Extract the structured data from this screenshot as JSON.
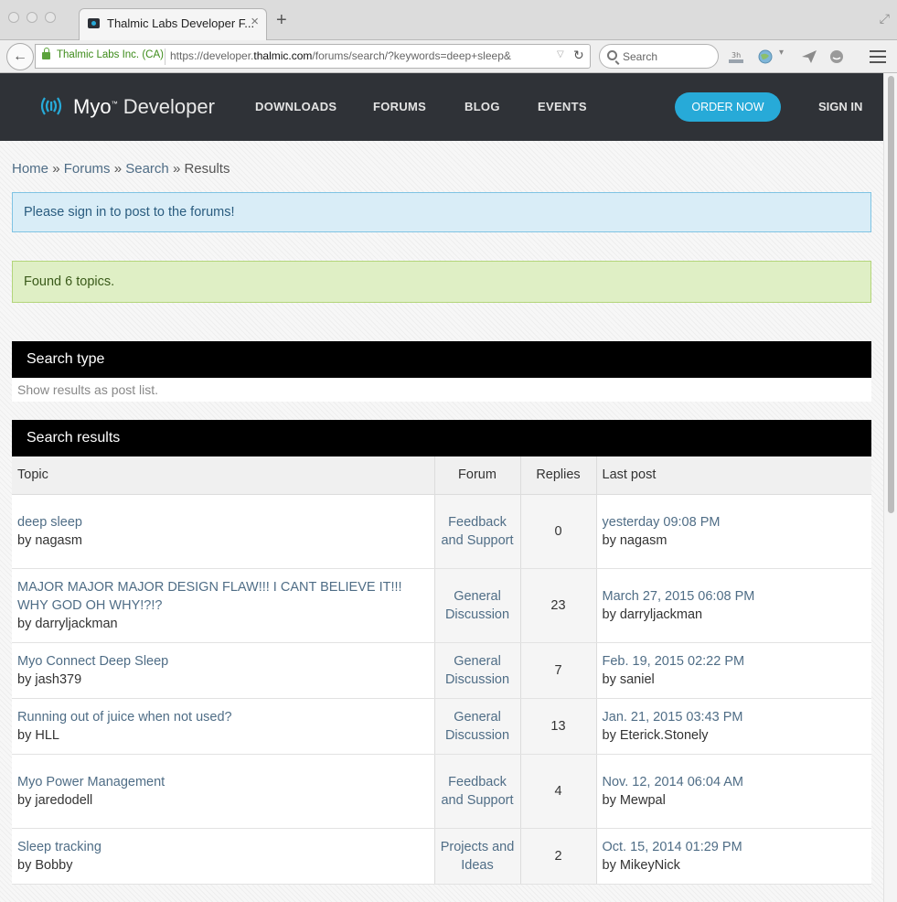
{
  "browser": {
    "tab_title": "Thalmic Labs Developer F...",
    "identity": "Thalmic Labs Inc. (CA)",
    "url_prefix": "https://developer.",
    "url_domain": "thalmic.com",
    "url_suffix": "/forums/search/?keywords=deep+sleep&",
    "search_placeholder": "Search"
  },
  "header": {
    "logo_brand": "Myo",
    "logo_suffix": "Developer",
    "nav": [
      "DOWNLOADS",
      "FORUMS",
      "BLOG",
      "EVENTS"
    ],
    "order_button": "ORDER NOW",
    "sign_in": "SIGN IN"
  },
  "breadcrumb": {
    "home": "Home",
    "forums": "Forums",
    "search": "Search",
    "current": "Results",
    "separator": "»"
  },
  "alerts": {
    "info": "Please sign in to post to the forums!",
    "success": "Found 6 topics."
  },
  "search_type": {
    "title": "Search type",
    "option": "Show results as post list."
  },
  "results": {
    "title": "Search results",
    "columns": {
      "topic": "Topic",
      "forum": "Forum",
      "replies": "Replies",
      "last_post": "Last post"
    },
    "rows": [
      {
        "topic": "deep sleep",
        "author": "by nagasm",
        "forum": "Feedback and Support",
        "replies": "0",
        "last_date": "yesterday 09:08 PM",
        "last_author": "by nagasm"
      },
      {
        "topic": "MAJOR MAJOR MAJOR DESIGN FLAW!!! I CANT BELIEVE IT!!! WHY GOD OH WHY!?!?",
        "author": "by darryljackman",
        "forum": "General Discussion",
        "replies": "23",
        "last_date": "March 27, 2015 06:08 PM",
        "last_author": "by darryljackman"
      },
      {
        "topic": "Myo Connect Deep Sleep",
        "author": "by jash379",
        "forum": "General Discussion",
        "replies": "7",
        "last_date": "Feb. 19, 2015 02:22 PM",
        "last_author": "by saniel"
      },
      {
        "topic": "Running out of juice when not used?",
        "author": "by HLL",
        "forum": "General Discussion",
        "replies": "13",
        "last_date": "Jan. 21, 2015 03:43 PM",
        "last_author": "by Eterick.Stonely"
      },
      {
        "topic": "Myo Power Management",
        "author": "by jaredodell",
        "forum": "Feedback and Support",
        "replies": "4",
        "last_date": "Nov. 12, 2014 06:04 AM",
        "last_author": "by Mewpal"
      },
      {
        "topic": "Sleep tracking",
        "author": "by Bobby",
        "forum": "Projects and Ideas",
        "replies": "2",
        "last_date": "Oct. 15, 2014 01:29 PM",
        "last_author": "by MikeyNick"
      }
    ]
  },
  "colors": {
    "accent": "#27aad8",
    "header_bg": "#2f3237",
    "link": "#4f6d86"
  }
}
